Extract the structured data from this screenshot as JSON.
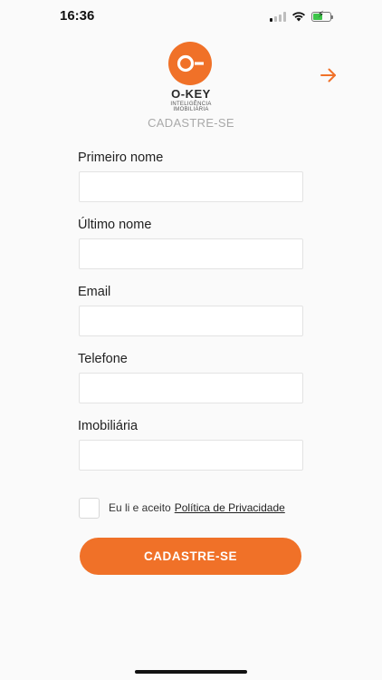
{
  "status_bar": {
    "time": "16:36",
    "icons": [
      "cellular-signal-icon",
      "wifi-icon",
      "battery-charging-icon"
    ]
  },
  "branding": {
    "logo_mark": "O-",
    "name": "O-KEY",
    "tagline_line1": "INTELIGÊNCIA",
    "tagline_line2": "IMOBILIÁRIA",
    "accent_color": "#f07128"
  },
  "header": {
    "subtitle": "CADASTRE-SE",
    "next_icon": "arrow-right-icon"
  },
  "form": {
    "fields": [
      {
        "label": "Primeiro nome",
        "value": ""
      },
      {
        "label": "Último nome",
        "value": ""
      },
      {
        "label": "Email",
        "value": ""
      },
      {
        "label": "Telefone",
        "value": ""
      },
      {
        "label": "Imobiliária",
        "value": ""
      }
    ],
    "consent": {
      "text": "Eu li e aceito",
      "link_text": "Política de Privacidade",
      "checked": false
    },
    "submit_label": "CADASTRE-SE"
  }
}
